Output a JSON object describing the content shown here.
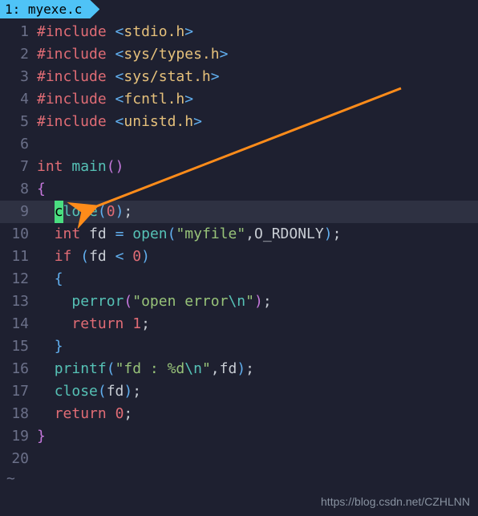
{
  "tab": {
    "index": "1:",
    "filename": "myexe.c"
  },
  "gutter": [
    "1",
    "2",
    "3",
    "4",
    "5",
    "6",
    "7",
    "8",
    "9",
    "10",
    "11",
    "12",
    "13",
    "14",
    "15",
    "16",
    "17",
    "18",
    "19",
    "20"
  ],
  "code": {
    "l1": {
      "inc": "#include",
      "lt": "<",
      "path": "stdio.h",
      "gt": ">"
    },
    "l2": {
      "inc": "#include",
      "lt": "<",
      "path": "sys/types.h",
      "gt": ">"
    },
    "l3": {
      "inc": "#include",
      "lt": "<",
      "path": "sys/stat.h",
      "gt": ">"
    },
    "l4": {
      "inc": "#include",
      "lt": "<",
      "path": "fcntl.h",
      "gt": ">"
    },
    "l5": {
      "inc": "#include",
      "lt": "<",
      "path": "unistd.h",
      "gt": ">"
    },
    "l7": {
      "type": "int",
      "fn": "main",
      "lp": "(",
      "rp": ")"
    },
    "l8": {
      "br": "{"
    },
    "l9": {
      "cur": "c",
      "rest": "lose",
      "lp": "(",
      "num": "0",
      "rp": ")",
      "semi": ";"
    },
    "l10": {
      "type": "int",
      "id": "fd",
      "eq": "=",
      "fn": "open",
      "lp": "(",
      "str": "\"myfile\"",
      "comma": ",",
      "macro": "O_RDONLY",
      "rp": ")",
      "semi": ";"
    },
    "l11": {
      "if": "if",
      "lp": "(",
      "id": "fd",
      "op": "<",
      "num": "0",
      "rp": ")"
    },
    "l12": {
      "br": "{"
    },
    "l13": {
      "fn": "perror",
      "lp": "(",
      "str1": "\"open error",
      "esc": "\\n",
      "str2": "\"",
      "rp": ")",
      "semi": ";"
    },
    "l14": {
      "ret": "return",
      "num": "1",
      "semi": ";"
    },
    "l15": {
      "br": "}"
    },
    "l16": {
      "fn": "printf",
      "lp": "(",
      "str1": "\"fd : %d",
      "esc": "\\n",
      "str2": "\"",
      "comma": ",",
      "id": "fd",
      "rp": ")",
      "semi": ";"
    },
    "l17": {
      "fn": "close",
      "lp": "(",
      "id": "fd",
      "rp": ")",
      "semi": ";"
    },
    "l18": {
      "ret": "return",
      "num": "0",
      "semi": ";"
    },
    "l19": {
      "br": "}"
    }
  },
  "tilde": "~",
  "watermark": "https://blog.csdn.net/CZHLNN",
  "colors": {
    "bg": "#1e2030",
    "tab": "#4fc3f7",
    "arrow": "#ff8c1a",
    "cursor": "#4ade80"
  }
}
